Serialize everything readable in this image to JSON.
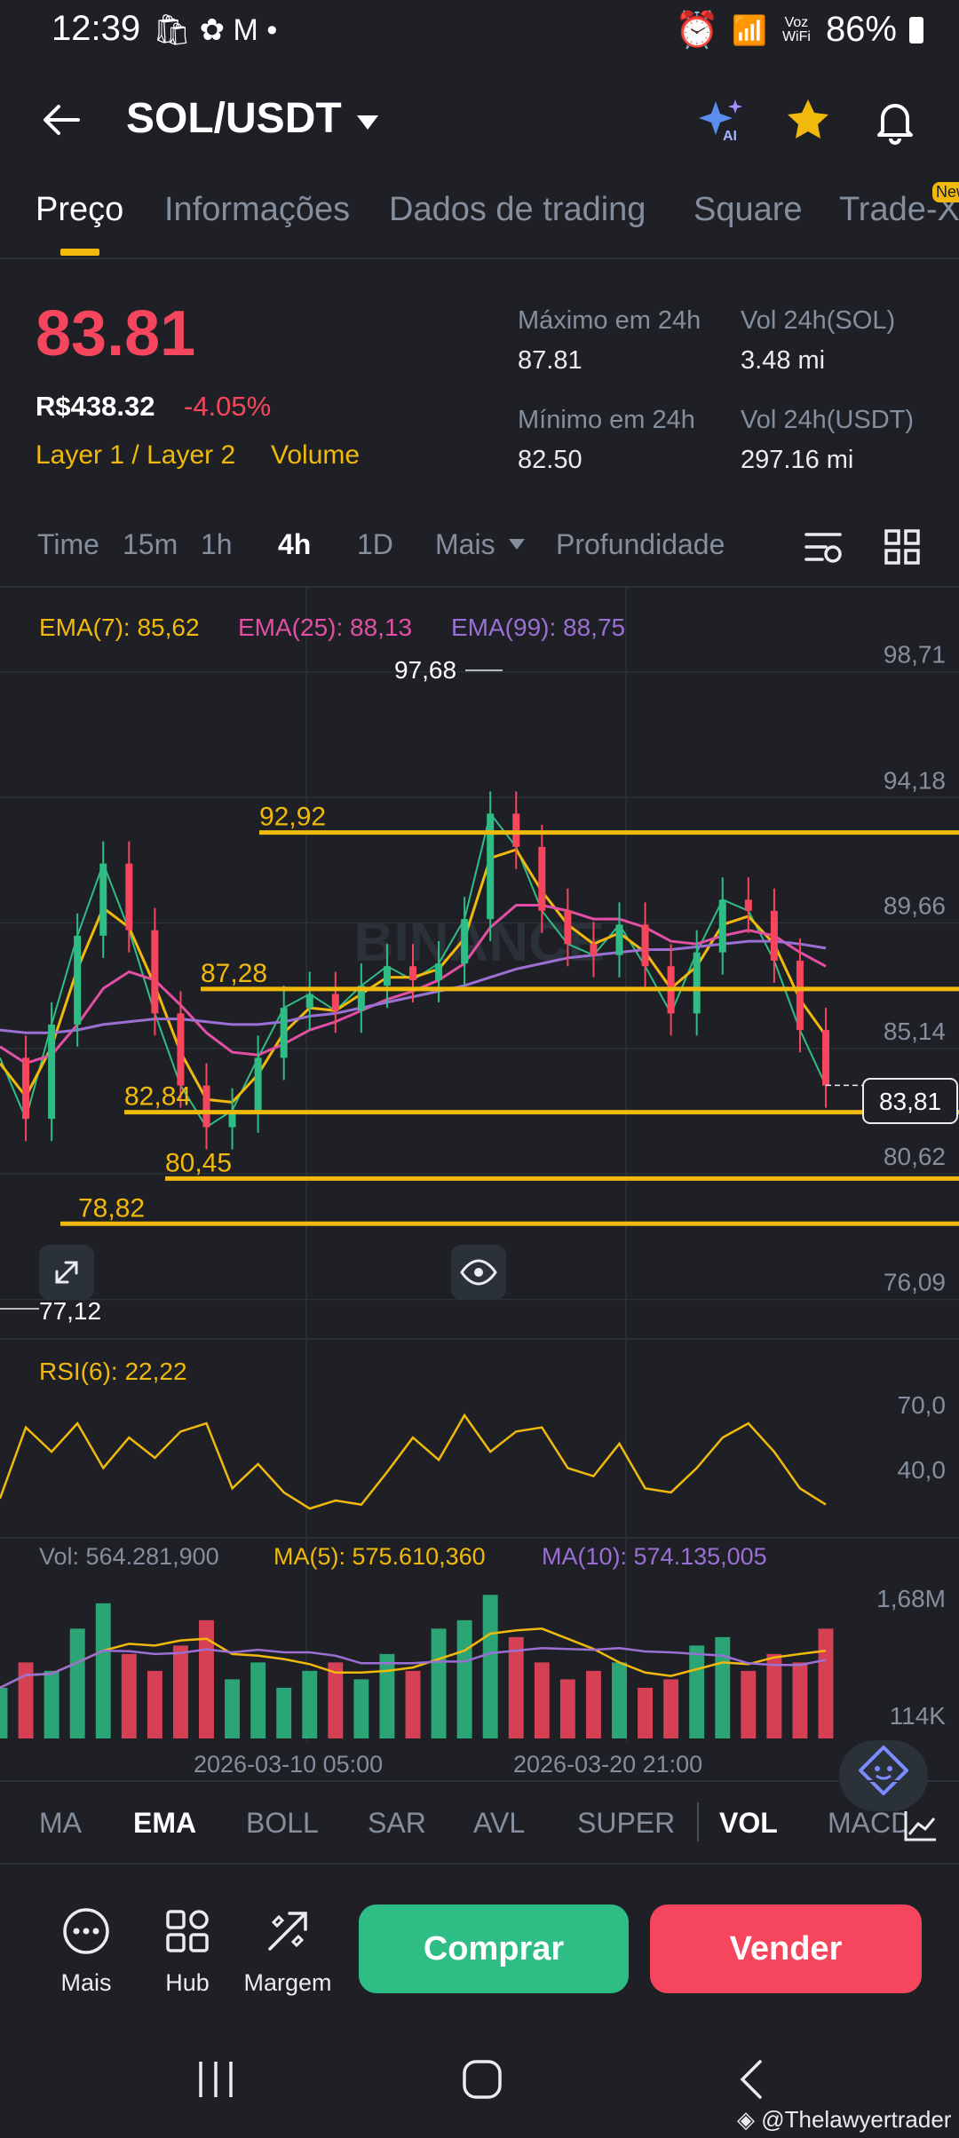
{
  "status_bar": {
    "time": "12:39",
    "battery": "86%",
    "network": "Voz WiFi"
  },
  "header": {
    "title": "SOL/USDT"
  },
  "tabs": [
    {
      "label": "Preço",
      "active": true
    },
    {
      "label": "Informações"
    },
    {
      "label": "Dados de trading"
    },
    {
      "label": "Square"
    },
    {
      "label": "Trade-X"
    }
  ],
  "tab_badge": "New",
  "price": {
    "last": "83.81",
    "brl": "R$438.32",
    "change": "-4.05%",
    "tags": [
      "Layer 1 / Layer 2",
      "Volume"
    ],
    "high_label": "Máximo em 24h",
    "high": "87.81",
    "low_label": "Mínimo em 24h",
    "low": "82.50",
    "vol_sol_label": "Vol 24h(SOL)",
    "vol_sol": "3.48 mi",
    "vol_usdt_label": "Vol 24h(USDT)",
    "vol_usdt": "297.16 mi"
  },
  "timeframes": [
    "Time",
    "15m",
    "1h",
    "4h",
    "1D",
    "Mais",
    "Profundidade"
  ],
  "timeframe_active": "4h",
  "ema_legend": {
    "ema7": "EMA(7): 85,62",
    "ema25": "EMA(25): 88,13",
    "ema99": "EMA(99): 88,75"
  },
  "price_axis": [
    "98,71",
    "94,18",
    "89,66",
    "85,14",
    "80,62",
    "76,09"
  ],
  "current_price_tag": "83,81",
  "level_labels": [
    "92,92",
    "87,28",
    "82,84",
    "80,45",
    "78,82"
  ],
  "extreme_labels": {
    "high": "97,68",
    "low": "77,12"
  },
  "watermark": "BINANCE",
  "rsi": {
    "label": "RSI(6): 22,22",
    "axis": [
      "70,0",
      "40,0"
    ]
  },
  "volume": {
    "vol": "Vol: 564.281,900",
    "ma5": "MA(5): 575.610,360",
    "ma10": "MA(10): 574.135,005",
    "axis": [
      "1,68M",
      "114K"
    ]
  },
  "date_labels": [
    "2026-03-10 05:00",
    "2026-03-20 21:00"
  ],
  "indicators": [
    "MA",
    "EMA",
    "BOLL",
    "SAR",
    "AVL",
    "SUPER",
    "VOL",
    "MACD"
  ],
  "bottom_tools": [
    "Mais",
    "Hub",
    "Margem"
  ],
  "buy_label": "Comprar",
  "sell_label": "Vender",
  "credit": "@Thelawyertrader",
  "colors": {
    "accent": "#f0b90b",
    "buy": "#2ebd85",
    "sell": "#f6465d",
    "ema25": "#e24fa4",
    "ema99": "#9b6fd4",
    "bg": "#1e2026"
  },
  "chart_data": {
    "type": "line",
    "series": [
      {
        "name": "SOL/USDT",
        "values": [
          84.8,
          82.6,
          86.0,
          89.2,
          91.8,
          89.4,
          86.4,
          83.8,
          82.3,
          82.9,
          84.8,
          86.6,
          87.1,
          86.5,
          87.4,
          88.1,
          87.6,
          88.2,
          89.8,
          93.6,
          92.4,
          90.1,
          88.9,
          88.5,
          89.6,
          88.1,
          86.4,
          88.6,
          90.5,
          90.1,
          88.3,
          85.8,
          83.8
        ]
      },
      {
        "name": "EMA(7)",
        "values": [
          84.6,
          83.4,
          85.2,
          88.0,
          90.2,
          89.5,
          87.4,
          85.0,
          83.3,
          83.2,
          84.2,
          85.7,
          86.6,
          86.5,
          87.1,
          87.7,
          87.7,
          88.0,
          89.1,
          92.0,
          92.3,
          90.8,
          89.6,
          88.9,
          89.3,
          88.6,
          87.3,
          88.1,
          89.6,
          89.9,
          88.9,
          86.9,
          85.6
        ]
      },
      {
        "name": "EMA(25)",
        "values": [
          85.2,
          84.6,
          84.9,
          86.0,
          87.3,
          87.9,
          87.6,
          86.7,
          85.7,
          85.0,
          84.9,
          85.3,
          85.8,
          86.1,
          86.5,
          86.9,
          87.2,
          87.6,
          88.2,
          89.5,
          90.3,
          90.3,
          90.1,
          89.8,
          89.8,
          89.5,
          89.0,
          88.9,
          89.2,
          89.4,
          89.2,
          88.6,
          88.1
        ]
      },
      {
        "name": "EMA(99)",
        "values": [
          85.8,
          85.7,
          85.7,
          85.8,
          86.0,
          86.1,
          86.2,
          86.2,
          86.1,
          86.0,
          86.0,
          86.1,
          86.3,
          86.4,
          86.6,
          86.8,
          87.0,
          87.2,
          87.4,
          87.7,
          88.0,
          88.2,
          88.4,
          88.5,
          88.6,
          88.7,
          88.7,
          88.8,
          88.9,
          89.0,
          89.0,
          88.9,
          88.75
        ]
      }
    ],
    "horizontal_lines": [
      92.92,
      87.28,
      82.84,
      80.45,
      78.82
    ],
    "high": 97.68,
    "low": 77.12,
    "last": 83.81,
    "ylim": [
      75.5,
      99.5
    ],
    "yticks": [
      98.71,
      94.18,
      89.66,
      85.14,
      80.62,
      76.09
    ],
    "rsi": {
      "values": [
        25,
        60,
        48,
        62,
        40,
        55,
        45,
        58,
        62,
        30,
        42,
        28,
        20,
        24,
        22,
        38,
        55,
        44,
        66,
        48,
        58,
        60,
        40,
        36,
        52,
        30,
        28,
        40,
        55,
        62,
        48,
        30,
        22
      ],
      "ylim": [
        10,
        80
      ]
    },
    "volume": {
      "values": [
        0.6,
        0.9,
        0.8,
        1.3,
        1.6,
        1.0,
        0.8,
        1.1,
        1.4,
        0.7,
        0.9,
        0.6,
        0.8,
        0.9,
        0.7,
        1.0,
        0.8,
        1.3,
        1.4,
        1.7,
        1.2,
        0.9,
        0.7,
        0.8,
        0.9,
        0.6,
        0.7,
        1.1,
        1.2,
        0.8,
        1.0,
        0.9,
        1.3
      ],
      "ylim": [
        0,
        1.85
      ]
    }
  }
}
